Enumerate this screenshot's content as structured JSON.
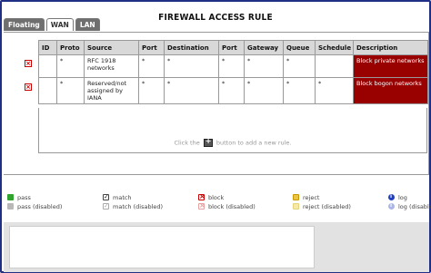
{
  "title": "FIREWALL ACCESS RULE",
  "tabs": [
    {
      "label": "Floating",
      "active": false
    },
    {
      "label": "WAN",
      "active": true
    },
    {
      "label": "LAN",
      "active": false
    }
  ],
  "table": {
    "headers": [
      "ID",
      "Proto",
      "Source",
      "Port",
      "Destination",
      "Port",
      "Gateway",
      "Queue",
      "Schedule",
      "Description"
    ],
    "rows": [
      {
        "status_icon": "block-icon",
        "id": "",
        "proto": "*",
        "source": "RFC 1918 networks",
        "port": "*",
        "destination": "*",
        "dport": "*",
        "gateway": "*",
        "queue": "*",
        "schedule": "",
        "description": "Block private networks"
      },
      {
        "status_icon": "block-icon",
        "id": "",
        "proto": "*",
        "source": "Reserved/not assigned by IANA",
        "port": "*",
        "destination": "*",
        "dport": "*",
        "gateway": "*",
        "queue": "*",
        "schedule": "*",
        "description": "Block bogon networks"
      }
    ]
  },
  "hint": {
    "before": "Click the",
    "after": "button to add a new rule."
  },
  "legend": [
    {
      "label": "pass",
      "icon": "pass-icon"
    },
    {
      "label": "pass (disabled)",
      "icon": "pass-disabled-icon"
    },
    {
      "label": "match",
      "icon": "match-icon"
    },
    {
      "label": "match (disabled)",
      "icon": "match-disabled-icon"
    },
    {
      "label": "block",
      "icon": "block-icon"
    },
    {
      "label": "block (disabled)",
      "icon": "block-disabled-icon"
    },
    {
      "label": "reject",
      "icon": "reject-icon"
    },
    {
      "label": "reject (disabled)",
      "icon": "reject-disabled-icon"
    },
    {
      "label": "log",
      "icon": "log-icon"
    },
    {
      "label": "log (disabled)",
      "icon": "log-disabled-icon"
    }
  ],
  "colors": {
    "description_bg": "#990000",
    "frame": "#1f2f86",
    "tab_inactive": "#6f6f6f"
  }
}
